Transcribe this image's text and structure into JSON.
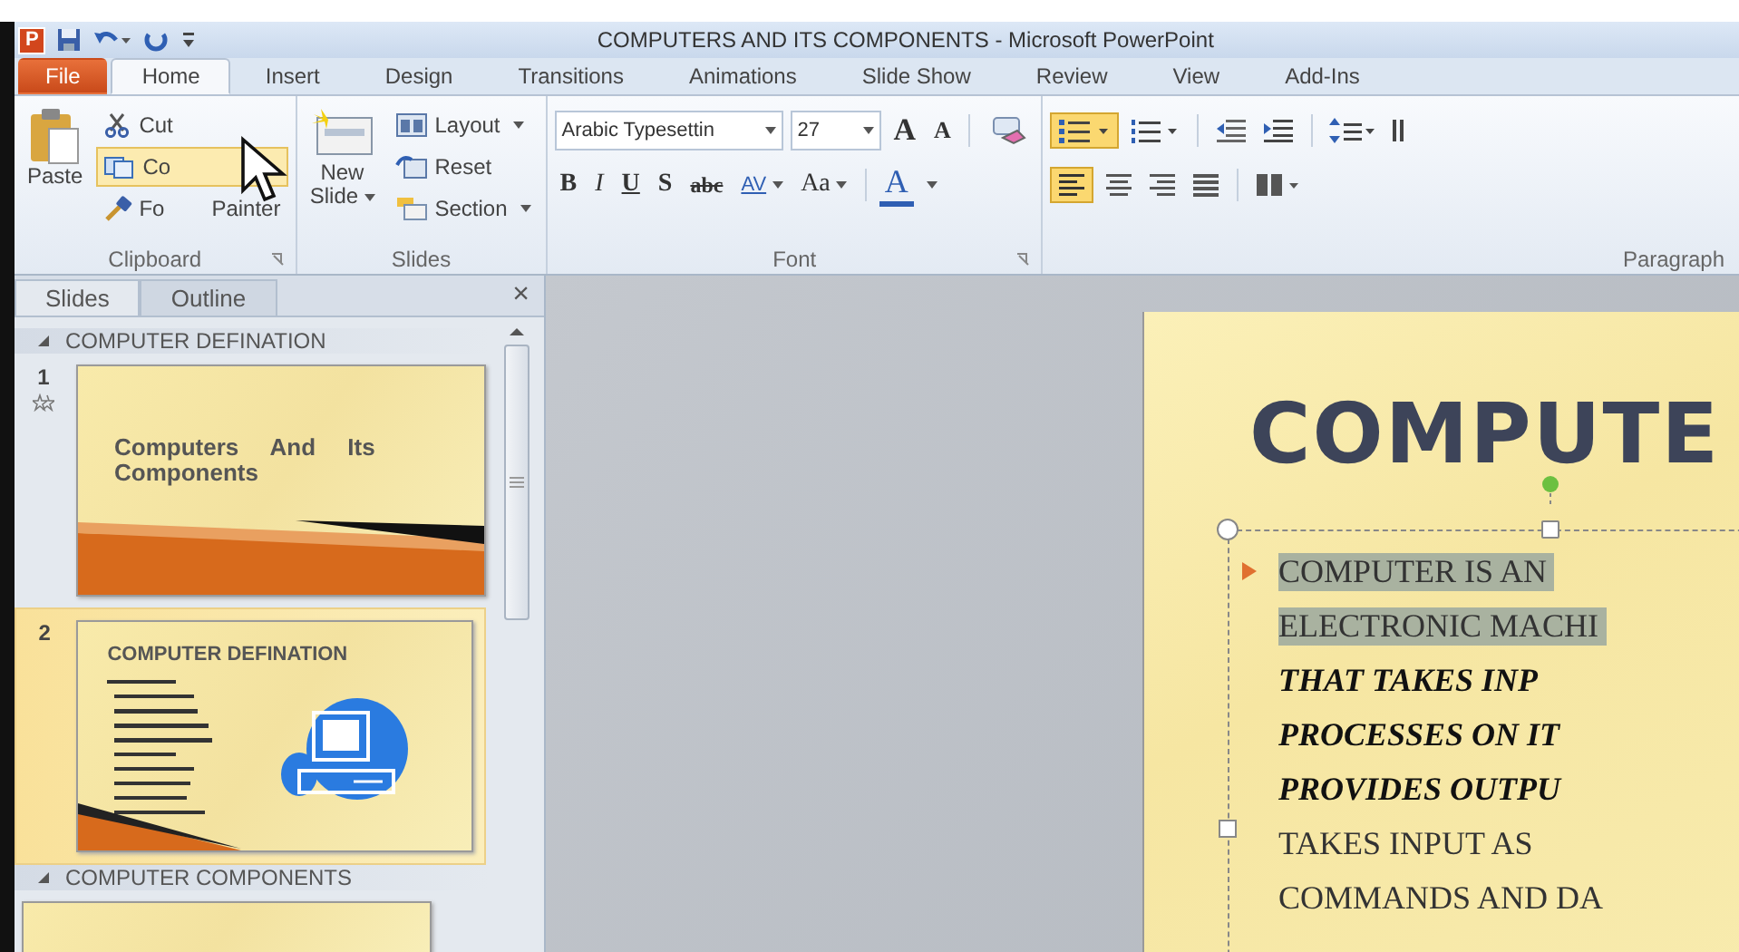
{
  "window": {
    "app_icon": "P",
    "title": "COMPUTERS AND ITS COMPONENTS  -  Microsoft PowerPoint"
  },
  "tabs": [
    {
      "label": "File",
      "kind": "file",
      "selected": false
    },
    {
      "label": "Home",
      "kind": "tab",
      "selected": true
    },
    {
      "label": "Insert",
      "kind": "tab",
      "selected": false
    },
    {
      "label": "Design",
      "kind": "tab",
      "selected": false
    },
    {
      "label": "Transitions",
      "kind": "tab",
      "selected": false
    },
    {
      "label": "Animations",
      "kind": "tab",
      "selected": false
    },
    {
      "label": "Slide Show",
      "kind": "tab",
      "selected": false
    },
    {
      "label": "Review",
      "kind": "tab",
      "selected": false
    },
    {
      "label": "View",
      "kind": "tab",
      "selected": false
    },
    {
      "label": "Add-Ins",
      "kind": "tab",
      "selected": false
    }
  ],
  "clipboard": {
    "label": "Clipboard",
    "paste": "Paste",
    "cut": "Cut",
    "copy": "Co",
    "format_painter": [
      "Fo",
      "Painter"
    ]
  },
  "slides_group": {
    "label": "Slides",
    "new_slide": [
      "New",
      "Slide"
    ],
    "layout": "Layout",
    "reset": "Reset",
    "section": "Section"
  },
  "font": {
    "label": "Font",
    "font_name": "Arabic Typesettin",
    "font_size": "27",
    "grow": "A",
    "shrink": "A",
    "bold": "B",
    "italic": "I",
    "underline": "U",
    "shadow": "S",
    "strike": "abc",
    "spacing": "AV",
    "case": "Aa",
    "font_color_letter": "A"
  },
  "paragraph": {
    "label": "Paragraph",
    "bullets_on": true,
    "align_left_on": true
  },
  "pane": {
    "close": "×",
    "tabs": [
      {
        "label": "Slides",
        "selected": true
      },
      {
        "label": "Outline",
        "selected": false
      }
    ],
    "sections": [
      {
        "title": "COMPUTER DEFINATION",
        "expanded": true,
        "slides": [
          {
            "number": "1",
            "kind": "title",
            "selected": false,
            "animated": true,
            "title": "Computers  And  Its Components"
          },
          {
            "number": "2",
            "kind": "content",
            "selected": true,
            "animated": false,
            "title": "COMPUTER  DEFINATION"
          }
        ]
      },
      {
        "title": "COMPUTER COMPONENTS",
        "expanded": true,
        "slides": [
          {
            "kind": "partial"
          }
        ]
      }
    ]
  },
  "slide": {
    "title": "COMPUTE",
    "lines": [
      {
        "text": "COMPUTER IS AN",
        "bullet": true,
        "italic": false,
        "selected": true
      },
      {
        "text": "ELECTRONIC MACHI",
        "bullet": false,
        "italic": false,
        "selected": true
      },
      {
        "text": "THAT TAKES INP",
        "bullet": false,
        "italic": true,
        "selected": false
      },
      {
        "text": "PROCESSES ON IT",
        "bullet": false,
        "italic": true,
        "selected": false
      },
      {
        "text": "PROVIDES OUTPU",
        "bullet": false,
        "italic": true,
        "selected": false
      },
      {
        "text": "TAKES INPUT AS",
        "bullet": false,
        "italic": false,
        "selected": false
      },
      {
        "text": "COMMANDS AND DA",
        "bullet": false,
        "italic": false,
        "selected": false
      }
    ]
  }
}
